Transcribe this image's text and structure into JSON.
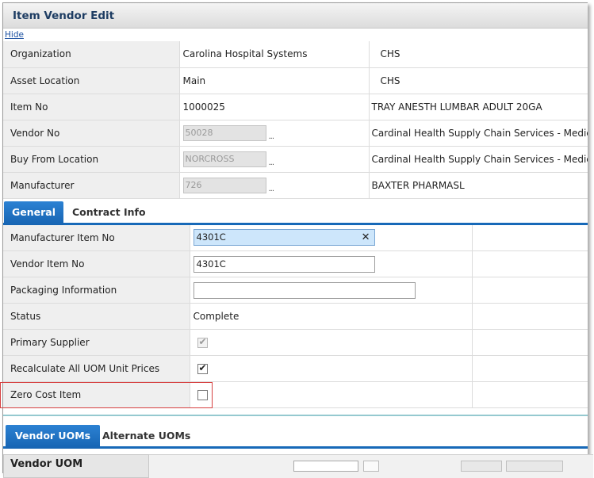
{
  "window": {
    "title": "Item Vendor Edit",
    "hide_link": "Hide"
  },
  "header_fields": [
    {
      "label": "Organization",
      "value": "Carolina Hospital Systems",
      "desc": "CHS",
      "readonly_input": false
    },
    {
      "label": "Asset Location",
      "value": "Main",
      "desc": "CHS",
      "readonly_input": false
    },
    {
      "label": "Item No",
      "value": "1000025",
      "desc": "TRAY ANESTH LUMBAR ADULT 20GA",
      "readonly_input": false
    },
    {
      "label": "Vendor No",
      "value": "50028",
      "desc": "Cardinal Health Supply Chain Services - Medica",
      "readonly_input": true
    },
    {
      "label": "Buy From Location",
      "value": "NORCROSS",
      "desc": "Cardinal Health Supply Chain Services - Medica",
      "readonly_input": true
    },
    {
      "label": "Manufacturer",
      "value": "726",
      "desc": "BAXTER PHARMASL",
      "readonly_input": true
    }
  ],
  "lookup_glyph": "...",
  "tabs": {
    "general": "General",
    "contract_info": "Contract Info"
  },
  "general": {
    "manufacturer_item_no": {
      "label": "Manufacturer Item No",
      "value": "4301C"
    },
    "vendor_item_no": {
      "label": "Vendor Item No",
      "value": "4301C"
    },
    "packaging_information": {
      "label": "Packaging Information",
      "value": ""
    },
    "status": {
      "label": "Status",
      "value": "Complete"
    },
    "primary_supplier": {
      "label": "Primary Supplier",
      "checked": true,
      "disabled": true
    },
    "recalculate_uom": {
      "label": "Recalculate All UOM Unit Prices",
      "checked": true
    },
    "zero_cost_item": {
      "label": "Zero Cost Item",
      "checked": false
    }
  },
  "uom_tabs": {
    "vendor_uoms": "Vendor UOMs",
    "alternate_uoms": "Alternate UOMs"
  },
  "vendor_uom_panel": {
    "title": "Vendor UOM"
  },
  "colors": {
    "accent": "#1769b8",
    "title_text": "#1e3d63",
    "highlight_box": "#d64040"
  }
}
